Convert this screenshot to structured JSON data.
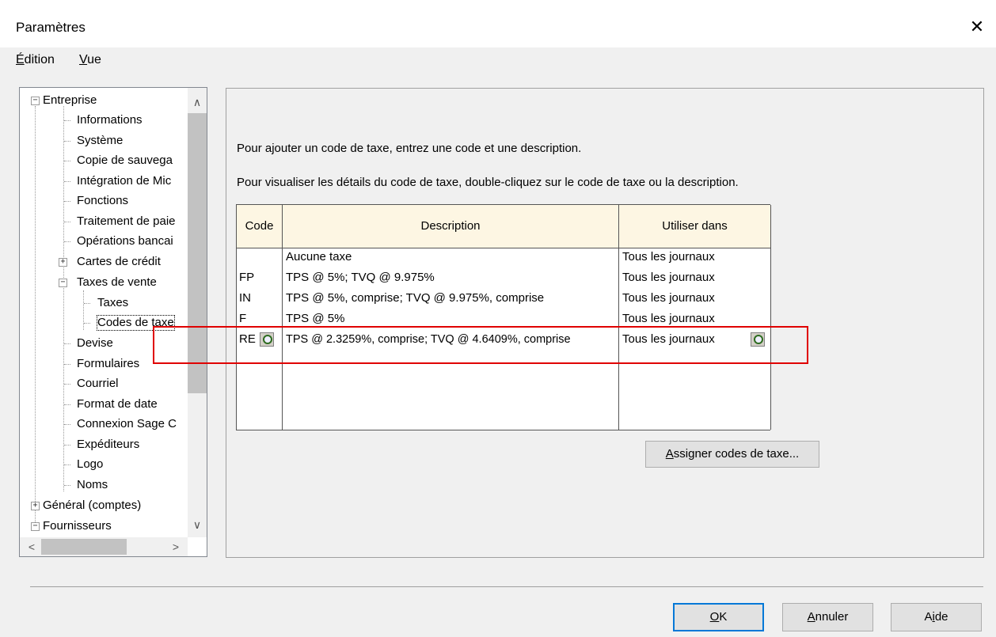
{
  "window": {
    "title": "Paramètres",
    "close_glyph": "✕"
  },
  "menu": {
    "edition": {
      "accel": "É",
      "rest": "dition"
    },
    "vue": {
      "accel": "V",
      "rest": "ue"
    }
  },
  "tree": {
    "items": [
      {
        "label": "Entreprise",
        "expander": "−"
      },
      {
        "label": "Informations"
      },
      {
        "label": "Système"
      },
      {
        "label": "Copie de sauvega"
      },
      {
        "label": "Intégration de Mic"
      },
      {
        "label": "Fonctions"
      },
      {
        "label": "Traitement de paie"
      },
      {
        "label": "Opérations bancai"
      },
      {
        "label": "Cartes de crédit",
        "expander": "+"
      },
      {
        "label": "Taxes de vente",
        "expander": "−"
      },
      {
        "label": "Taxes"
      },
      {
        "label": "Codes de taxe"
      },
      {
        "label": "Devise"
      },
      {
        "label": "Formulaires"
      },
      {
        "label": "Courriel"
      },
      {
        "label": "Format de date"
      },
      {
        "label": "Connexion Sage C"
      },
      {
        "label": "Expéditeurs"
      },
      {
        "label": "Logo"
      },
      {
        "label": "Noms"
      },
      {
        "label": "Général (comptes)",
        "expander": "+"
      },
      {
        "label": "Fournisseurs",
        "expander": "−"
      }
    ],
    "scroll_up": "∧",
    "scroll_down": "∨",
    "scroll_left": "<",
    "scroll_right": ">"
  },
  "main": {
    "info1": "Pour ajouter un code de taxe, entrez une code et une description.",
    "info2": "Pour visualiser les détails du code de taxe, double-cliquez sur le code de taxe ou la description.",
    "columns": [
      "Code",
      "Description",
      "Utiliser dans"
    ],
    "rows": [
      {
        "code": "",
        "description": "Aucune taxe",
        "use": "Tous les journaux"
      },
      {
        "code": "FP",
        "description": "TPS @ 5%; TVQ @ 9.975%",
        "use": "Tous les journaux"
      },
      {
        "code": "IN",
        "description": "TPS @ 5%, comprise; TVQ @ 9.975%, comprise",
        "use": "Tous les journaux"
      },
      {
        "code": "F",
        "description": "TPS @ 5%",
        "use": "Tous les journaux"
      },
      {
        "code": "RE",
        "description": "TPS @ 2.3259%, comprise; TVQ @ 4.6409%, comprise",
        "use": "Tous les journaux"
      }
    ],
    "assign_button": {
      "accel": "A",
      "rest": "ssigner codes de taxe..."
    }
  },
  "footer": {
    "ok": {
      "accel": "O",
      "rest": "K"
    },
    "cancel": {
      "accel": "A",
      "rest": "nnuler"
    },
    "help": {
      "pre": "A",
      "accel": "i",
      "rest": "de"
    }
  },
  "colors": {
    "highlight": "#e00000",
    "header_bg": "#fdf6e3",
    "ok_border": "#0078d7"
  }
}
